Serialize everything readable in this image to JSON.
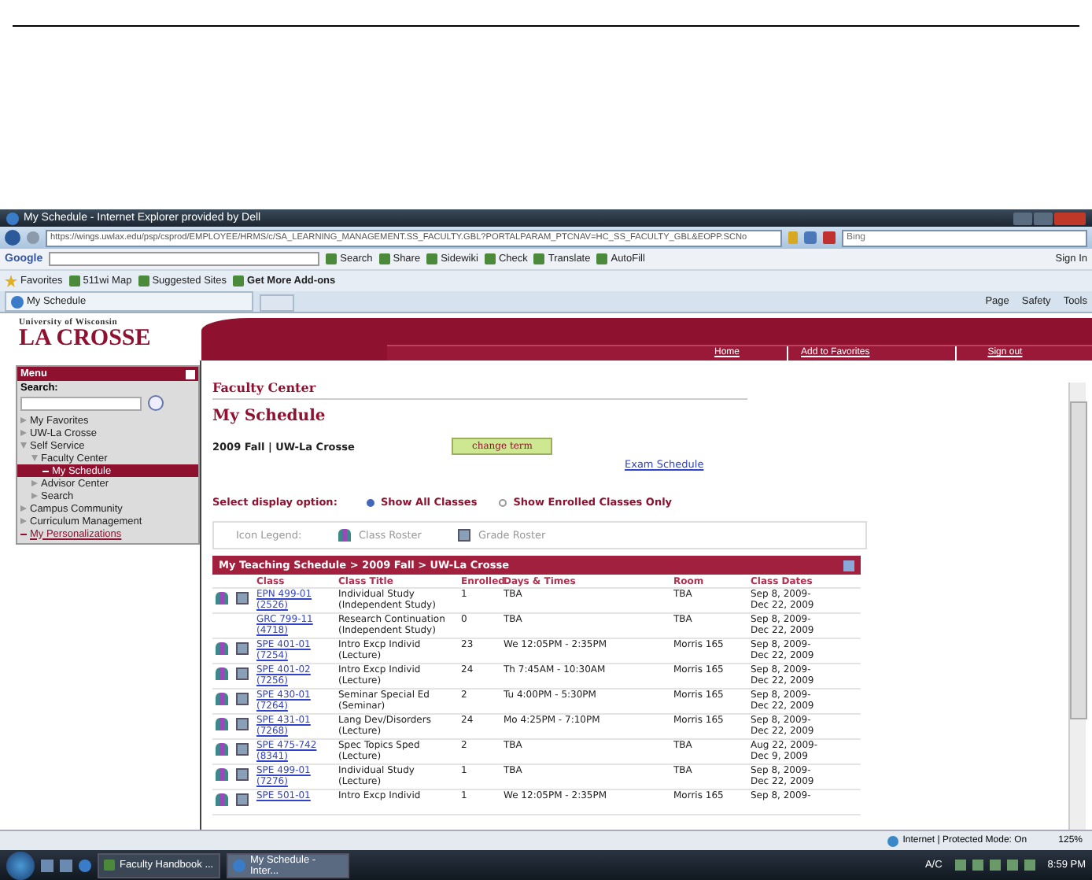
{
  "browser": {
    "title": "My Schedule - Internet Explorer provided by Dell",
    "url": "https://wings.uwlax.edu/psp/csprod/EMPLOYEE/HRMS/c/SA_LEARNING_MANAGEMENT.SS_FACULTY.GBL?PORTALPARAM_PTCNAV=HC_SS_FACULTY_GBL&EOPP.SCNo",
    "search_placeholder": "Bing",
    "google_label": "Google",
    "google_items": [
      "Search",
      "Share",
      "Sidewiki",
      "Check",
      "Translate",
      "AutoFill"
    ],
    "sign_in": "Sign In",
    "favorites": [
      "Favorites",
      "511wi Map",
      "Suggested Sites",
      "Get More Add-ons"
    ],
    "tab": "My Schedule",
    "commands": [
      "Page",
      "Safety",
      "Tools"
    ]
  },
  "header": {
    "logo_top": "University of Wisconsin",
    "logo_main": "LA CROSSE",
    "nav_links": [
      "Home",
      "Add to Favorites",
      "Sign out"
    ]
  },
  "menu": {
    "title": "Menu",
    "search_label": "Search:",
    "items": [
      {
        "label": "My Favorites",
        "expanded": false,
        "selected": false
      },
      {
        "label": "UW-La Crosse",
        "expanded": false,
        "selected": false
      },
      {
        "label": "Self Service",
        "expanded": true,
        "selected": false,
        "children": [
          {
            "label": "Faculty Center",
            "expanded": true,
            "selected": false,
            "children": [
              {
                "label": "My Schedule",
                "kind": "leaf",
                "selected": true
              }
            ]
          },
          {
            "label": "Advisor Center",
            "expanded": false,
            "selected": false
          },
          {
            "label": "Search",
            "expanded": false,
            "selected": false
          }
        ]
      },
      {
        "label": "Campus Community",
        "expanded": false,
        "selected": false
      },
      {
        "label": "Curriculum Management",
        "expanded": false,
        "selected": false
      },
      {
        "label": "My Personalizations",
        "kind": "leaf",
        "selected": false
      }
    ]
  },
  "content": {
    "section": "Faculty Center",
    "heading": "My Schedule",
    "term": "2009 Fall | UW-La Crosse",
    "change_button": "change term",
    "exam_link": "Exam Schedule",
    "display_label": "Select display option:",
    "display_options": [
      {
        "label": "Show All Classes",
        "selected": true
      },
      {
        "label": "Show Enrolled Classes Only",
        "selected": false
      }
    ],
    "legend_label": "Icon Legend:",
    "legend": [
      "Class Roster",
      "Grade Roster"
    ],
    "table": {
      "title": "My Teaching Schedule > 2009 Fall > UW-La Crosse",
      "columns": [
        "Class",
        "Class Title",
        "Enrolled",
        "Days & Times",
        "Room",
        "Class Dates"
      ],
      "rows": [
        {
          "roster_icons": true,
          "class": "EPN 499-01",
          "number": "(2526)",
          "title": "Individual Study",
          "component": "(Independent Study)",
          "enrolled": "1",
          "days_times": "TBA",
          "room": "TBA",
          "start": "Sep 8, 2009-",
          "end": "Dec 22, 2009"
        },
        {
          "roster_icons": false,
          "class": "GRC 799-11",
          "number": "(4718)",
          "title": "Research Continuation",
          "component": "(Independent Study)",
          "enrolled": "0",
          "days_times": "TBA",
          "room": "TBA",
          "start": "Sep 8, 2009-",
          "end": "Dec 22, 2009"
        },
        {
          "roster_icons": true,
          "class": "SPE 401-01",
          "number": "(7254)",
          "title": "Intro Excp Individ",
          "component": "(Lecture)",
          "enrolled": "23",
          "days_times": "We 12:05PM - 2:35PM",
          "room": "Morris 165",
          "start": "Sep 8, 2009-",
          "end": "Dec 22, 2009"
        },
        {
          "roster_icons": true,
          "class": "SPE 401-02",
          "number": "(7256)",
          "title": "Intro Excp Individ",
          "component": "(Lecture)",
          "enrolled": "24",
          "days_times": "Th 7:45AM - 10:30AM",
          "room": "Morris 165",
          "start": "Sep 8, 2009-",
          "end": "Dec 22, 2009"
        },
        {
          "roster_icons": true,
          "class": "SPE 430-01",
          "number": "(7264)",
          "title": "Seminar Special Ed",
          "component": "(Seminar)",
          "enrolled": "2",
          "days_times": "Tu 4:00PM - 5:30PM",
          "room": "Morris 165",
          "start": "Sep 8, 2009-",
          "end": "Dec 22, 2009"
        },
        {
          "roster_icons": true,
          "class": "SPE 431-01",
          "number": "(7268)",
          "title": "Lang Dev/Disorders",
          "component": "(Lecture)",
          "enrolled": "24",
          "days_times": "Mo 4:25PM - 7:10PM",
          "room": "Morris 165",
          "start": "Sep 8, 2009-",
          "end": "Dec 22, 2009"
        },
        {
          "roster_icons": true,
          "class": "SPE 475-742",
          "number": "(8341)",
          "title": "Spec Topics Sped",
          "component": "(Lecture)",
          "enrolled": "2",
          "days_times": "TBA",
          "room": "TBA",
          "start": "Aug 22, 2009-",
          "end": "Dec 9, 2009"
        },
        {
          "roster_icons": true,
          "class": "SPE 499-01",
          "number": "(7276)",
          "title": "Individual Study",
          "component": "(Lecture)",
          "enrolled": "1",
          "days_times": "TBA",
          "room": "TBA",
          "start": "Sep 8, 2009-",
          "end": "Dec 22, 2009"
        },
        {
          "roster_icons": true,
          "class": "SPE 501-01",
          "title": "Intro Excp Individ",
          "enrolled": "1",
          "days_times": "We 12:05PM - 2:35PM",
          "room": "Morris 165",
          "start": "Sep 8, 2009-"
        }
      ]
    }
  },
  "status_bar": {
    "zone": "Internet | Protected Mode: On",
    "zoom": "125%"
  },
  "taskbar": {
    "windows": [
      {
        "label": "Faculty Handbook ...",
        "selected": false
      },
      {
        "label": "My Schedule - Inter...",
        "selected": true
      }
    ],
    "tray_text": "A/C",
    "clock": "8:59 PM"
  }
}
